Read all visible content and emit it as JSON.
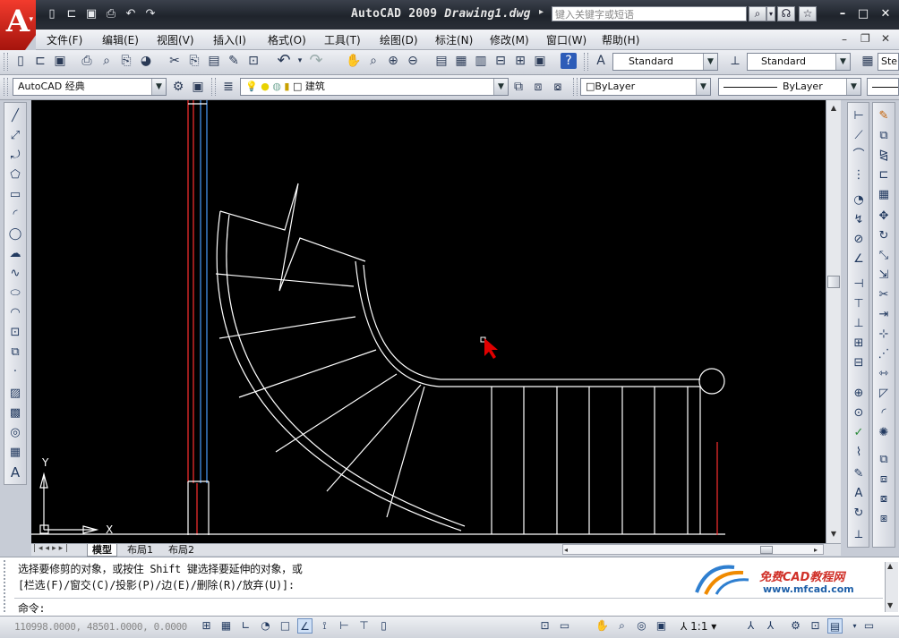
{
  "app": {
    "name_prefix": "AutoCAD 2009",
    "document": "Drawing1.dwg",
    "logo_letter": "A",
    "logo_dropdown": "▾"
  },
  "titlebar": {
    "search_placeholder": "键入关键字或短语",
    "search_icon": "binoculars-icon"
  },
  "menu": {
    "items": [
      "文件(F)",
      "编辑(E)",
      "视图(V)",
      "插入(I)",
      "格式(O)",
      "工具(T)",
      "绘图(D)",
      "标注(N)",
      "修改(M)",
      "窗口(W)",
      "帮助(H)"
    ]
  },
  "toolbar": {
    "text_style": "Standard",
    "dim_style": "Standard",
    "table_style_partial": "Ste",
    "workspace": "AutoCAD 经典",
    "layer": "建筑",
    "color": "ByLayer",
    "linetype": "ByLayer"
  },
  "tabs": [
    "模型",
    "布局1",
    "布局2"
  ],
  "axes": {
    "x": "X",
    "y": "Y"
  },
  "command": {
    "line1": "选择要修剪的对象，或按住 Shift 键选择要延伸的对象，或",
    "line2": "[栏选(F)/窗交(C)/投影(P)/边(E)/删除(R)/放弃(U)]:",
    "prompt": "命令:"
  },
  "watermark": {
    "brand": "免费CAD教程网",
    "url": "www.mfcad.com"
  },
  "status": {
    "coordinates": "110998.0000, 48501.0000, 0.0000",
    "scale": "1:1"
  },
  "colors": {
    "accent_red": "#d81e10",
    "drawing_bg": "#000000",
    "cursor": "#e00000"
  }
}
